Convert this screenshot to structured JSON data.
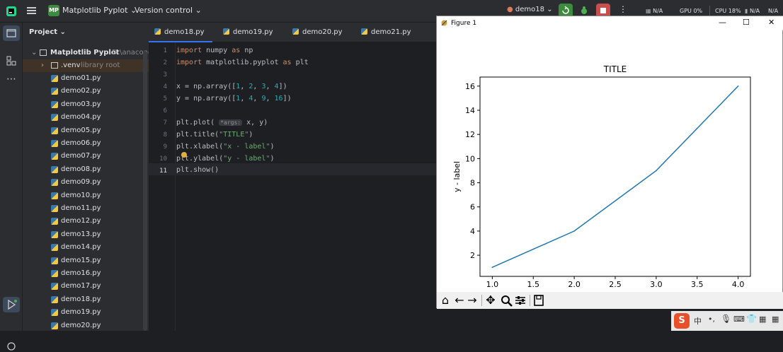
{
  "app": {
    "project_name": "Matplotlib Pyplot",
    "project_badge": "MP",
    "vcs": "Version control",
    "run_config": "demo18",
    "status": {
      "gpu_left": "N/A",
      "gpu_label": "GPU",
      "gpu_val": "0%",
      "cpu_label": "CPU",
      "cpu_val": "18%",
      "mem": "N/A"
    }
  },
  "project_panel": {
    "title": "Project",
    "root": "Matplotlib Pyplot",
    "root_path": "D:\\anacond",
    "venv": ".venv",
    "venv_note": "library root",
    "files": [
      "demo01.py",
      "demo02.py",
      "demo03.py",
      "demo04.py",
      "demo05.py",
      "demo06.py",
      "demo07.py",
      "demo08.py",
      "demo09.py",
      "demo10.py",
      "demo11.py",
      "demo12.py",
      "demo13.py",
      "demo14.py",
      "demo15.py",
      "demo16.py",
      "demo17.py",
      "demo18.py",
      "demo19.py",
      "demo20.py"
    ]
  },
  "editor": {
    "tabs": [
      "demo18.py",
      "demo19.py",
      "demo20.py",
      "demo21.py"
    ],
    "active_tab": "demo18.py",
    "line_numbers": [
      "1",
      "2",
      "3",
      "4",
      "5",
      "6",
      "7",
      "8",
      "9",
      "10",
      "11"
    ],
    "lines": {
      "l1": [
        "import",
        " numpy ",
        "as",
        " np"
      ],
      "l2": [
        "import",
        " matplotlib.pyplot ",
        "as",
        " plt"
      ],
      "l4": [
        "x = np.array([",
        "1",
        ", ",
        "2",
        ", ",
        "3",
        ", ",
        "4",
        "])"
      ],
      "l5": [
        "y = np.array([",
        "1",
        ", ",
        "4",
        ", ",
        "9",
        ", ",
        "16",
        "])"
      ],
      "l7": [
        "plt.plot( ",
        "*args:",
        " x, y)"
      ],
      "l8": [
        "plt.title(",
        "\"TITLE\"",
        ")"
      ],
      "l9": [
        "plt.xlabel(",
        "\"x - label\"",
        ")"
      ],
      "l10": [
        "plt.ylabel(",
        "\"y - label\"",
        ")"
      ],
      "l11": "plt.show()"
    }
  },
  "figure_window": {
    "title": "Figure 1",
    "controls": [
      "—",
      "☐",
      "✕"
    ]
  },
  "chart_data": {
    "type": "line",
    "title": "TITLE",
    "xlabel": "x - label",
    "ylabel": "y - label",
    "x": [
      1,
      2,
      3,
      4
    ],
    "series": [
      {
        "values": [
          1,
          4,
          9,
          16
        ],
        "color": "#1f77b4"
      }
    ],
    "xticks": [
      "1.0",
      "1.5",
      "2.0",
      "2.5",
      "3.0",
      "3.5",
      "4.0"
    ],
    "yticks": [
      "2",
      "4",
      "6",
      "8",
      "10",
      "12",
      "14",
      "16"
    ],
    "xlim": [
      0.85,
      4.15
    ],
    "ylim": [
      0.25,
      16.75
    ]
  },
  "taskbar": {
    "ime": "中"
  }
}
